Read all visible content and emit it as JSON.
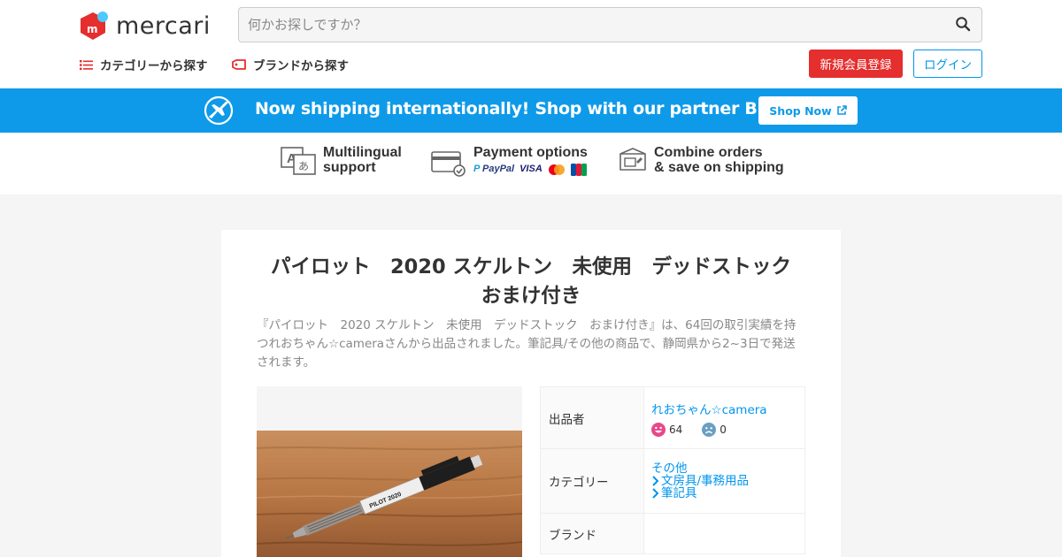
{
  "header": {
    "logo_text": "mercari",
    "search_placeholder": "何かお探しですか？",
    "nav": [
      {
        "label": "カテゴリーから探す",
        "icon": "list-icon"
      },
      {
        "label": "ブランドから探す",
        "icon": "tag-icon"
      }
    ],
    "signup_label": "新規会員登録",
    "login_label": "ログイン"
  },
  "banner": {
    "text": "Now shipping internationally! Shop with our partner Buyee!",
    "button_label": "Shop Now",
    "icon": "airplane-icon"
  },
  "features": [
    {
      "line1": "Multilingual",
      "line2": "support",
      "icon": "translate-icon"
    },
    {
      "line1": "Payment options",
      "line2": "",
      "icon": "credit-card-icon",
      "logos": [
        "PayPal",
        "VISA",
        "mastercard",
        "JCB"
      ]
    },
    {
      "line1": "Combine orders",
      "line2": "& save on shipping",
      "icon": "box-icon"
    }
  ],
  "product": {
    "title": "パイロット　2020 スケルトン　未使用　デッドストック　おまけ付き",
    "description": "『パイロット　2020 スケルトン　未使用　デッドストック　おまけ付き』は、64回の取引実績を持つれおちゃん☆cameraさんから出品されました。筆記具/その他の商品で、静岡県から2~3日で発送されます。",
    "image_alt_icon": "pencil-photo",
    "pencil_label": "PILOT 2020"
  },
  "info": {
    "seller_label": "出品者",
    "seller_name": "れおちゃん☆camera",
    "rating_good": "64",
    "rating_bad": "0",
    "category_label": "カテゴリー",
    "categories": [
      "その他",
      "文房具/事務用品",
      "筆記具"
    ],
    "brand_label": "ブランド",
    "brand_value": ""
  },
  "colors": {
    "brand_red": "#e52e2e",
    "link_blue": "#0095ee",
    "banner_blue": "#0f9ae9"
  }
}
